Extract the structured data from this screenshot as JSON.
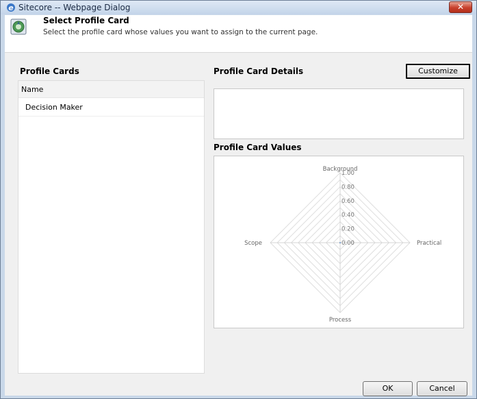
{
  "window": {
    "title": "Sitecore -- Webpage Dialog",
    "close_glyph": "✕",
    "icon": "internet-explorer-icon"
  },
  "header": {
    "title": "Select Profile Card",
    "subtitle": "Select the profile card whose values you want to assign to the current page.",
    "icon": "profile-card-icon"
  },
  "left_panel": {
    "heading": "Profile Cards",
    "column_header": "Name",
    "items": [
      {
        "label": "Decision Maker"
      }
    ]
  },
  "right_panel": {
    "details_heading": "Profile Card Details",
    "customize_label": "Customize",
    "values_heading": "Profile Card Values"
  },
  "chart_data": {
    "type": "radar",
    "axes": [
      "Background",
      "Practical",
      "Process",
      "Scope"
    ],
    "values": [
      0,
      0,
      0,
      0
    ],
    "ticks": [
      "0.00",
      "0.20",
      "0.40",
      "0.60",
      "0.80",
      "1.00"
    ],
    "range": [
      0,
      1
    ]
  },
  "footer": {
    "ok_label": "OK",
    "cancel_label": "Cancel"
  }
}
